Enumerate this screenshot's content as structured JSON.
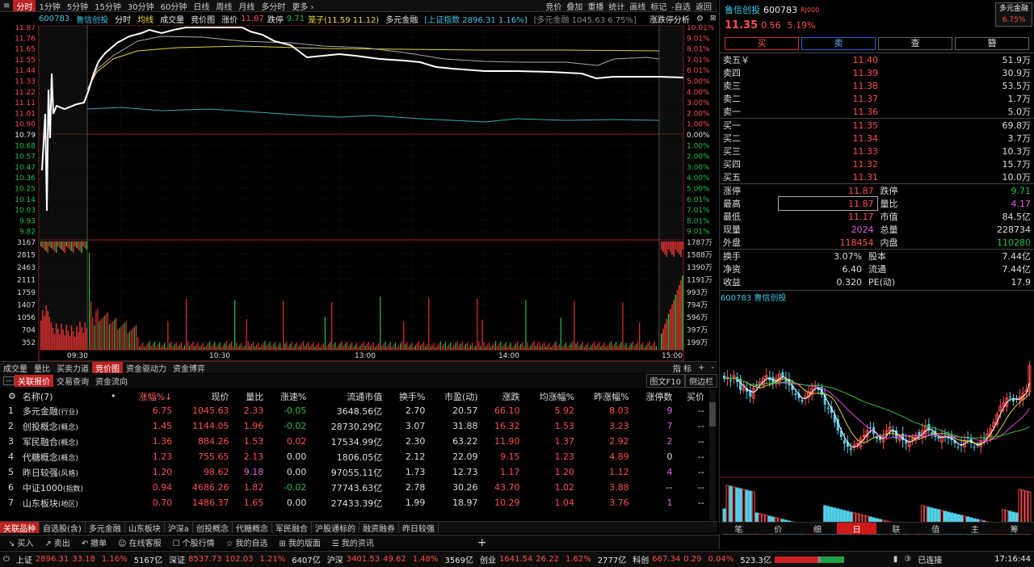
{
  "topbar": {
    "tabs": [
      "分时",
      "1分钟",
      "5分钟",
      "15分钟",
      "30分钟",
      "60分钟",
      "日线",
      "周线",
      "月线",
      "多分时",
      "更多 ›"
    ],
    "right": [
      "竞价",
      "叠加",
      "重播",
      "统计",
      "画线",
      "标记",
      "-自选",
      "返回"
    ]
  },
  "info": {
    "code": "600783",
    "name": "鲁信创投",
    "items": [
      "分时",
      "均线",
      "成交量",
      "竞价图"
    ],
    "zhangjia": "涨价",
    "zhangjia_v": "11.87",
    "dieting": "跌停",
    "dieting_v": "9.71",
    "dingzi": "笼子(11.59 11.12)",
    "dyrj": "多元金融",
    "sh_label": "[上证指数 2896.31 1.16%]",
    "sector_label": "[多元金融 1045.63 6.75%]",
    "right_btn": "涨跌停分析"
  },
  "price_axis": {
    "left": [
      "11.87",
      "11.76",
      "11.65",
      "11.55",
      "11.44",
      "11.33",
      "11.22",
      "11.11",
      "11.01",
      "10.90",
      "10.79",
      "10.68",
      "10.57",
      "10.47",
      "10.36",
      "10.25",
      "10.14",
      "10.03",
      "9.93",
      "9.82"
    ],
    "right": [
      "10.01%",
      "9.01%",
      "8.01%",
      "7.01%",
      "6.01%",
      "5.00%",
      "4.00%",
      "3.00%",
      "2.00%",
      "1.00%",
      "0.00%",
      "1.00%",
      "2.00%",
      "3.00%",
      "4.00%",
      "5.00%",
      "6.01%",
      "7.01%",
      "8.01%",
      "9.01%"
    ]
  },
  "vol_axis": {
    "left": [
      "3167",
      "2815",
      "2463",
      "2111",
      "1759",
      "1407",
      "1056",
      "704",
      "352"
    ],
    "right": [
      "1787万",
      "1588万",
      "1390万",
      "1191万",
      "993万",
      "794万",
      "596万",
      "397万",
      "199万"
    ]
  },
  "time_axis": [
    "09:30",
    "10:30",
    "13:00",
    "14:00",
    "15:00"
  ],
  "left_tabs": [
    "成交量",
    "量比",
    "买卖力道",
    "竞价图",
    "资金驱动力",
    "资金博弈"
  ],
  "left_tabs_right": [
    "指 标",
    "+",
    "-"
  ],
  "sub_tabs": [
    "关联报价",
    "交易查询",
    "资金流向"
  ],
  "sub_tabs_right": [
    "图文F10",
    "侧边栏"
  ],
  "table": {
    "headers": [
      "名称(7)",
      "•",
      "涨幅%↓",
      "现价",
      "量比",
      "涨速%",
      "流通市值",
      "换手%",
      "市盈(动)",
      "涨跌",
      "均涨幅%",
      "昨涨幅%",
      "涨停数",
      "买价"
    ],
    "rows": [
      {
        "n": "1",
        "name": "多元金融",
        "tag": "(行业)",
        "chg": "6.75",
        "price": "1045.63",
        "lb": "2.33",
        "zs": "-0.05",
        "ltsz": "3648.56亿",
        "hs": "2.70",
        "pe": "20.57",
        "zd": "66.10",
        "avg": "5.92",
        "yest": "8.03",
        "zt": "9",
        "buy": "--"
      },
      {
        "n": "2",
        "name": "创投概念",
        "tag": "(概念)",
        "chg": "1.45",
        "price": "1144.05",
        "lb": "1.96",
        "zs": "-0.02",
        "ltsz": "28730.29亿",
        "hs": "3.07",
        "pe": "31.88",
        "zd": "16.32",
        "avg": "1.53",
        "yest": "3.23",
        "zt": "7",
        "buy": "--"
      },
      {
        "n": "3",
        "name": "军民融合",
        "tag": "(概念)",
        "chg": "1.36",
        "price": "884.26",
        "lb": "1.53",
        "zs": "0.02",
        "ltsz": "17534.99亿",
        "hs": "2.30",
        "pe": "63.22",
        "zd": "11.90",
        "avg": "1.37",
        "yest": "2.92",
        "zt": "2",
        "buy": "--"
      },
      {
        "n": "4",
        "name": "代糖概念",
        "tag": "(概念)",
        "chg": "1.23",
        "price": "755.65",
        "lb": "2.13",
        "zs": "0.00",
        "ltsz": "1806.05亿",
        "hs": "2.12",
        "pe": "22.09",
        "zd": "9.15",
        "avg": "1.23",
        "yest": "4.89",
        "zt": "0",
        "buy": "--"
      },
      {
        "n": "5",
        "name": "昨日较强",
        "tag": "(风格)",
        "chg": "1.20",
        "price": "98.62",
        "lb": "9.18",
        "zs": "0.00",
        "ltsz": "97055.11亿",
        "hs": "1.73",
        "pe": "12.73",
        "zd": "1.17",
        "avg": "1.20",
        "yest": "1.12",
        "zt": "4",
        "buy": "--"
      },
      {
        "n": "6",
        "name": "中证1000",
        "tag": "(指数)",
        "chg": "0.94",
        "price": "4686.26",
        "lb": "1.82",
        "zs": "-0.02",
        "ltsz": "77743.63亿",
        "hs": "2.78",
        "pe": "30.26",
        "zd": "43.70",
        "avg": "1.02",
        "yest": "3.88",
        "zt": "--",
        "buy": "--"
      },
      {
        "n": "7",
        "name": "山东板块",
        "tag": "(地区)",
        "chg": "0.70",
        "price": "1486.37",
        "lb": "1.65",
        "zs": "0.00",
        "ltsz": "27433.39亿",
        "hs": "1.99",
        "pe": "18.97",
        "zd": "10.29",
        "avg": "1.04",
        "yest": "3.76",
        "zt": "1",
        "buy": "--"
      }
    ]
  },
  "bottom_tabs": [
    "关联品种",
    "自选股(含)",
    "多元金融",
    "山东板块",
    "沪深a",
    "创投概念",
    "代糖概念",
    "军民融合",
    "沪股通标的",
    "融资融券",
    "昨日较强"
  ],
  "actions": [
    "买入",
    "卖出",
    "撤单",
    "在线客服",
    "个股行情",
    "我的自选",
    "我的版面",
    "我的资讯"
  ],
  "status": {
    "sh": "上证",
    "sh_v": "2896.31",
    "sh_c": "33.18",
    "sh_p": "1.16%",
    "sh_amt": "5167亿",
    "sz": "深证",
    "sz_v": "8537.73",
    "sz_c": "102.03",
    "sz_p": "1.21%",
    "sz_amt": "6407亿",
    "hs": "沪深",
    "hs_v": "3401.53",
    "hs_c": "49.62",
    "hs_p": "1.48%",
    "hs_amt": "3569亿",
    "cy": "创业",
    "cy_v": "1641.54",
    "cy_c": "26.22",
    "cy_p": "1.62%",
    "cy_amt": "2777亿",
    "kc": "科创",
    "kc_v": "667.34",
    "kc_c": "0.29",
    "kc_p": "0.04%",
    "kc_amt": "523.3亿",
    "conn": "已连接",
    "time": "17:16:44"
  },
  "right": {
    "name": "鲁信创投",
    "code": "600783",
    "badge": "RJ000",
    "price": "11.35",
    "chg": "0.56",
    "pct": "5.19%",
    "sector": "多元金融",
    "sector_pct": "6.75%",
    "btns": [
      "买",
      "卖",
      "查",
      "簪"
    ],
    "asks": [
      [
        "卖五￥",
        "11.40",
        "51.9万"
      ],
      [
        "卖四",
        "11.39",
        "30.9万"
      ],
      [
        "卖三",
        "11.38",
        "53.5万"
      ],
      [
        "卖二",
        "11.37",
        "1.7万"
      ],
      [
        "卖一",
        "11.36",
        "5.0万"
      ]
    ],
    "bids": [
      [
        "买一",
        "11.35",
        "69.8万"
      ],
      [
        "买二",
        "11.34",
        "3.7万"
      ],
      [
        "买三",
        "11.33",
        "10.3万"
      ],
      [
        "买四",
        "11.32",
        "15.7万"
      ],
      [
        "买五",
        "11.31",
        "10.0万"
      ]
    ],
    "stats1": [
      [
        "涨停",
        "11.87",
        "跌停",
        "9.71"
      ],
      [
        "最高",
        "11.87",
        "量比",
        "4.17"
      ],
      [
        "最低",
        "11.17",
        "市值",
        "84.5亿"
      ],
      [
        "现量",
        "2024",
        "总量",
        "228734"
      ],
      [
        "外盘",
        "118454",
        "内盘",
        "110280"
      ]
    ],
    "stats2": [
      [
        "换手",
        "3.07%",
        "股本",
        "7.44亿"
      ],
      [
        "净资",
        "6.40",
        "流通",
        "7.44亿"
      ],
      [
        "收益",
        "0.320",
        "PE(动)",
        "17.9"
      ]
    ],
    "kline_label": "600783 鲁信创投",
    "tabs": [
      "笔",
      "价",
      "细",
      "日",
      "联",
      "值",
      "主",
      "筹"
    ]
  }
}
